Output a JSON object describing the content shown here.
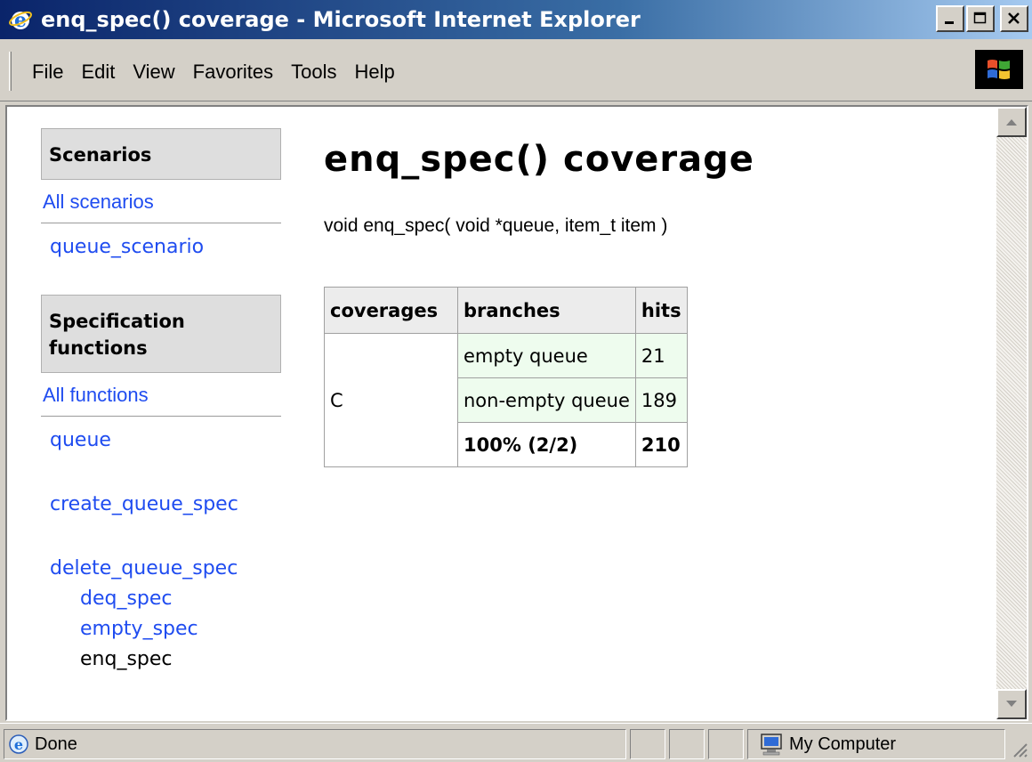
{
  "window": {
    "title": "enq_spec() coverage - Microsoft Internet Explorer"
  },
  "menu": {
    "items": [
      "File",
      "Edit",
      "View",
      "Favorites",
      "Tools",
      "Help"
    ]
  },
  "sidebar": {
    "scenarios_heading": "Scenarios",
    "all_scenarios": "All scenarios",
    "scenarios": [
      "queue_scenario"
    ],
    "functions_heading_line1": "Specification",
    "functions_heading_line2": "functions",
    "all_functions": "All functions",
    "functions": {
      "queue": "queue",
      "create_queue_spec": "create_queue_spec",
      "delete_queue_spec": "delete_queue_spec",
      "deq_spec": "deq_spec",
      "empty_spec": "empty_spec",
      "enq_spec": "enq_spec"
    }
  },
  "main": {
    "title": "enq_spec() coverage",
    "signature": "void enq_spec( void *queue, item_t item )",
    "table": {
      "headers": [
        "coverages",
        "branches",
        "hits"
      ],
      "coverage_name": "C",
      "rows": [
        {
          "branch": "empty queue",
          "hits": "21"
        },
        {
          "branch": "non-empty queue",
          "hits": "189"
        }
      ],
      "total_branch": "100% (2/2)",
      "total_hits": "210"
    }
  },
  "status": {
    "text": "Done",
    "zone": "My Computer"
  },
  "icons": {
    "title": "ie-logo-icon",
    "status": "ie-page-icon",
    "zone": "computer-icon"
  },
  "colors": {
    "link": "#1f4cf0",
    "title_bar": "#0a246a",
    "branch_cell": "#eefcee"
  }
}
